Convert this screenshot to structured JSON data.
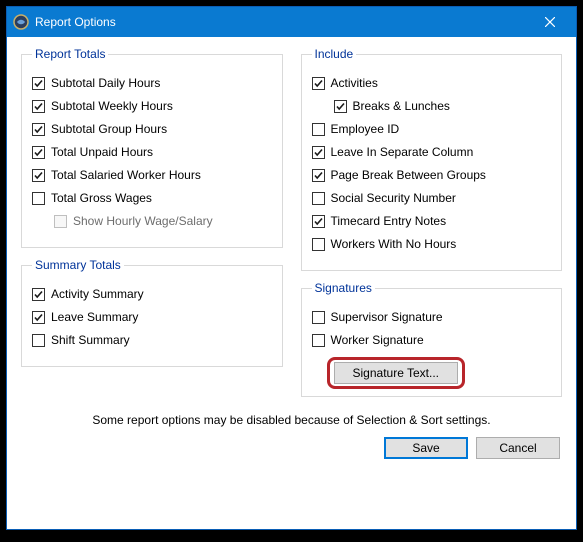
{
  "window": {
    "title": "Report Options"
  },
  "report_totals": {
    "legend": "Report Totals",
    "items": [
      {
        "label": "Subtotal Daily Hours",
        "checked": true,
        "disabled": false,
        "name": "checkbox-subtotal-daily-hours"
      },
      {
        "label": "Subtotal Weekly Hours",
        "checked": true,
        "disabled": false,
        "name": "checkbox-subtotal-weekly-hours"
      },
      {
        "label": "Subtotal Group Hours",
        "checked": true,
        "disabled": false,
        "name": "checkbox-subtotal-group-hours"
      },
      {
        "label": "Total Unpaid Hours",
        "checked": true,
        "disabled": false,
        "name": "checkbox-total-unpaid-hours"
      },
      {
        "label": "Total Salaried Worker Hours",
        "checked": true,
        "disabled": false,
        "name": "checkbox-total-salaried-worker-hours"
      },
      {
        "label": "Total Gross Wages",
        "checked": false,
        "disabled": false,
        "name": "checkbox-total-gross-wages"
      }
    ],
    "sub_item": {
      "label": "Show Hourly Wage/Salary",
      "checked": false,
      "disabled": true,
      "name": "checkbox-show-hourly-wage-salary"
    }
  },
  "summary_totals": {
    "legend": "Summary Totals",
    "items": [
      {
        "label": "Activity Summary",
        "checked": true,
        "name": "checkbox-activity-summary"
      },
      {
        "label": "Leave Summary",
        "checked": true,
        "name": "checkbox-leave-summary"
      },
      {
        "label": "Shift Summary",
        "checked": false,
        "name": "checkbox-shift-summary"
      }
    ]
  },
  "include": {
    "legend": "Include",
    "items_top": [
      {
        "label": "Activities",
        "checked": true,
        "name": "checkbox-activities"
      }
    ],
    "sub_item": {
      "label": "Breaks & Lunches",
      "checked": true,
      "name": "checkbox-breaks-lunches"
    },
    "items_rest": [
      {
        "label": "Employee ID",
        "checked": false,
        "name": "checkbox-employee-id"
      },
      {
        "label": "Leave In Separate Column",
        "checked": true,
        "name": "checkbox-leave-separate-column"
      },
      {
        "label": "Page Break Between Groups",
        "checked": true,
        "name": "checkbox-page-break-groups"
      },
      {
        "label": "Social Security Number",
        "checked": false,
        "name": "checkbox-ssn"
      },
      {
        "label": "Timecard Entry Notes",
        "checked": true,
        "name": "checkbox-timecard-entry-notes"
      },
      {
        "label": "Workers With No Hours",
        "checked": false,
        "name": "checkbox-workers-no-hours"
      }
    ]
  },
  "signatures": {
    "legend": "Signatures",
    "items": [
      {
        "label": "Supervisor Signature",
        "checked": false,
        "name": "checkbox-supervisor-signature"
      },
      {
        "label": "Worker Signature",
        "checked": false,
        "name": "checkbox-worker-signature"
      }
    ],
    "button_label": "Signature Text..."
  },
  "footer": {
    "note": "Some report options may be disabled because of Selection & Sort settings.",
    "save": "Save",
    "cancel": "Cancel"
  }
}
